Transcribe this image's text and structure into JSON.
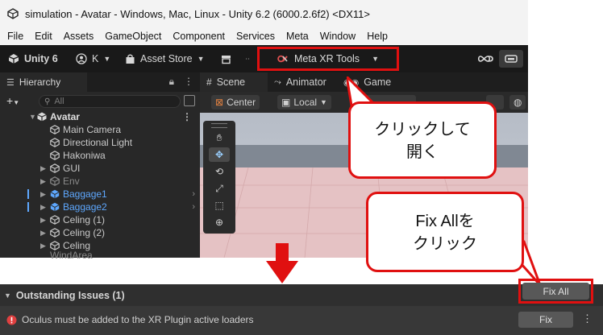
{
  "window": {
    "title": "simulation - Avatar - Windows, Mac, Linux - Unity 6.2 (6000.2.6f2) <DX11>"
  },
  "menu": [
    "File",
    "Edit",
    "Assets",
    "GameObject",
    "Component",
    "Services",
    "Meta",
    "Window",
    "Help"
  ],
  "toolbar": {
    "unity_label": "Unity 6",
    "account_label": "K",
    "asset_store_label": "Asset Store",
    "meta_xr_label": "Meta XR Tools"
  },
  "hierarchy": {
    "tab_label": "Hierarchy",
    "search_placeholder": "All",
    "scene_name": "Avatar",
    "items": [
      {
        "label": "Main Camera"
      },
      {
        "label": "Directional Light"
      },
      {
        "label": "Hakoniwa"
      },
      {
        "label": "GUI"
      },
      {
        "label": "Env"
      },
      {
        "label": "Baggage1"
      },
      {
        "label": "Baggage2"
      },
      {
        "label": "Celing (1)"
      },
      {
        "label": "Celing (2)"
      },
      {
        "label": "Celing"
      },
      {
        "label": "WindArea"
      }
    ]
  },
  "scene": {
    "tabs": [
      "Scene",
      "Animator",
      "Game"
    ],
    "pivot_label": "Center",
    "space_label": "Local"
  },
  "callouts": {
    "open": {
      "line1": "クリックして",
      "line2": "開く"
    },
    "fixall": {
      "line1": "Fix Allを",
      "line2": "クリック"
    }
  },
  "issues": {
    "header": "Outstanding Issues (1)",
    "fix_all_label": "Fix All",
    "message": "Oculus must be added to the XR Plugin active loaders",
    "fix_label": "Fix"
  },
  "colors": {
    "highlight": "#e01010",
    "selected_text": "#5ea8ff",
    "env_text": "#8a8a8a"
  }
}
